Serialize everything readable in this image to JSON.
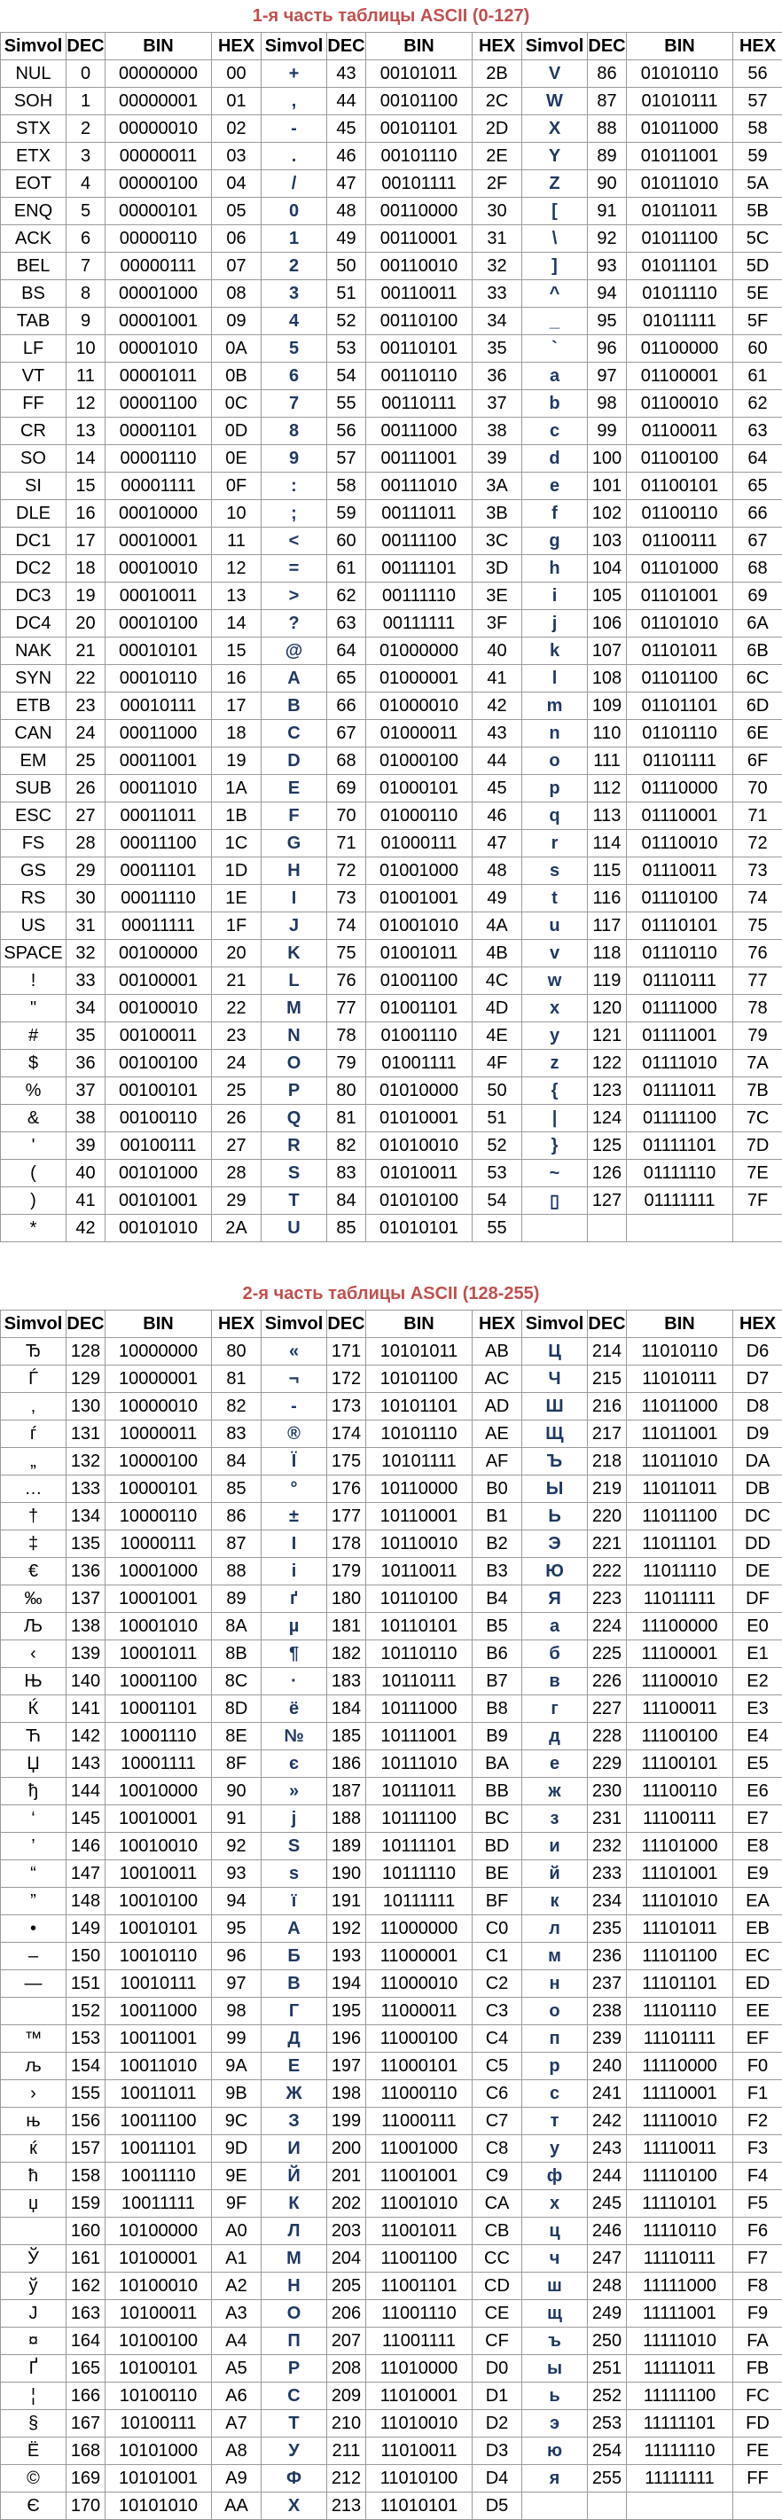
{
  "style": {
    "title_color": "#c0504d",
    "symbol_color": "#1f3864"
  },
  "part1": {
    "title": "1-я часть таблицы ASCII (0-127)",
    "headers": [
      "Simvol",
      "DEC",
      "BIN",
      "HEX",
      "Simvol",
      "DEC",
      "BIN",
      "HEX",
      "Simvol",
      "DEC",
      "BIN",
      "HEX"
    ],
    "rows": [
      [
        "NUL",
        "0",
        "00000000",
        "00",
        "+",
        "43",
        "00101011",
        "2B",
        "V",
        "86",
        "01010110",
        "56"
      ],
      [
        "SOH",
        "1",
        "00000001",
        "01",
        ",",
        "44",
        "00101100",
        "2C",
        "W",
        "87",
        "01010111",
        "57"
      ],
      [
        "STX",
        "2",
        "00000010",
        "02",
        "-",
        "45",
        "00101101",
        "2D",
        "X",
        "88",
        "01011000",
        "58"
      ],
      [
        "ETX",
        "3",
        "00000011",
        "03",
        ".",
        "46",
        "00101110",
        "2E",
        "Y",
        "89",
        "01011001",
        "59"
      ],
      [
        "EOT",
        "4",
        "00000100",
        "04",
        "/",
        "47",
        "00101111",
        "2F",
        "Z",
        "90",
        "01011010",
        "5A"
      ],
      [
        "ENQ",
        "5",
        "00000101",
        "05",
        "0",
        "48",
        "00110000",
        "30",
        "[",
        "91",
        "01011011",
        "5B"
      ],
      [
        "ACK",
        "6",
        "00000110",
        "06",
        "1",
        "49",
        "00110001",
        "31",
        "\\",
        "92",
        "01011100",
        "5C"
      ],
      [
        "BEL",
        "7",
        "00000111",
        "07",
        "2",
        "50",
        "00110010",
        "32",
        "]",
        "93",
        "01011101",
        "5D"
      ],
      [
        "BS",
        "8",
        "00001000",
        "08",
        "3",
        "51",
        "00110011",
        "33",
        "^",
        "94",
        "01011110",
        "5E"
      ],
      [
        "TAB",
        "9",
        "00001001",
        "09",
        "4",
        "52",
        "00110100",
        "34",
        "_",
        "95",
        "01011111",
        "5F"
      ],
      [
        "LF",
        "10",
        "00001010",
        "0A",
        "5",
        "53",
        "00110101",
        "35",
        "`",
        "96",
        "01100000",
        "60"
      ],
      [
        "VT",
        "11",
        "00001011",
        "0B",
        "6",
        "54",
        "00110110",
        "36",
        "a",
        "97",
        "01100001",
        "61"
      ],
      [
        "FF",
        "12",
        "00001100",
        "0C",
        "7",
        "55",
        "00110111",
        "37",
        "b",
        "98",
        "01100010",
        "62"
      ],
      [
        "CR",
        "13",
        "00001101",
        "0D",
        "8",
        "56",
        "00111000",
        "38",
        "c",
        "99",
        "01100011",
        "63"
      ],
      [
        "SO",
        "14",
        "00001110",
        "0E",
        "9",
        "57",
        "00111001",
        "39",
        "d",
        "100",
        "01100100",
        "64"
      ],
      [
        "SI",
        "15",
        "00001111",
        "0F",
        ":",
        "58",
        "00111010",
        "3A",
        "e",
        "101",
        "01100101",
        "65"
      ],
      [
        "DLE",
        "16",
        "00010000",
        "10",
        ";",
        "59",
        "00111011",
        "3B",
        "f",
        "102",
        "01100110",
        "66"
      ],
      [
        "DC1",
        "17",
        "00010001",
        "11",
        "<",
        "60",
        "00111100",
        "3C",
        "g",
        "103",
        "01100111",
        "67"
      ],
      [
        "DC2",
        "18",
        "00010010",
        "12",
        "=",
        "61",
        "00111101",
        "3D",
        "h",
        "104",
        "01101000",
        "68"
      ],
      [
        "DC3",
        "19",
        "00010011",
        "13",
        ">",
        "62",
        "00111110",
        "3E",
        "i",
        "105",
        "01101001",
        "69"
      ],
      [
        "DC4",
        "20",
        "00010100",
        "14",
        "?",
        "63",
        "00111111",
        "3F",
        "j",
        "106",
        "01101010",
        "6A"
      ],
      [
        "NAK",
        "21",
        "00010101",
        "15",
        "@",
        "64",
        "01000000",
        "40",
        "k",
        "107",
        "01101011",
        "6B"
      ],
      [
        "SYN",
        "22",
        "00010110",
        "16",
        "A",
        "65",
        "01000001",
        "41",
        "l",
        "108",
        "01101100",
        "6C"
      ],
      [
        "ETB",
        "23",
        "00010111",
        "17",
        "B",
        "66",
        "01000010",
        "42",
        "m",
        "109",
        "01101101",
        "6D"
      ],
      [
        "CAN",
        "24",
        "00011000",
        "18",
        "C",
        "67",
        "01000011",
        "43",
        "n",
        "110",
        "01101110",
        "6E"
      ],
      [
        "EM",
        "25",
        "00011001",
        "19",
        "D",
        "68",
        "01000100",
        "44",
        "o",
        "111",
        "01101111",
        "6F"
      ],
      [
        "SUB",
        "26",
        "00011010",
        "1A",
        "E",
        "69",
        "01000101",
        "45",
        "p",
        "112",
        "01110000",
        "70"
      ],
      [
        "ESC",
        "27",
        "00011011",
        "1B",
        "F",
        "70",
        "01000110",
        "46",
        "q",
        "113",
        "01110001",
        "71"
      ],
      [
        "FS",
        "28",
        "00011100",
        "1C",
        "G",
        "71",
        "01000111",
        "47",
        "r",
        "114",
        "01110010",
        "72"
      ],
      [
        "GS",
        "29",
        "00011101",
        "1D",
        "H",
        "72",
        "01001000",
        "48",
        "s",
        "115",
        "01110011",
        "73"
      ],
      [
        "RS",
        "30",
        "00011110",
        "1E",
        "I",
        "73",
        "01001001",
        "49",
        "t",
        "116",
        "01110100",
        "74"
      ],
      [
        "US",
        "31",
        "00011111",
        "1F",
        "J",
        "74",
        "01001010",
        "4A",
        "u",
        "117",
        "01110101",
        "75"
      ],
      [
        "SPACE",
        "32",
        "00100000",
        "20",
        "K",
        "75",
        "01001011",
        "4B",
        "v",
        "118",
        "01110110",
        "76"
      ],
      [
        "!",
        "33",
        "00100001",
        "21",
        "L",
        "76",
        "01001100",
        "4C",
        "w",
        "119",
        "01110111",
        "77"
      ],
      [
        "\"",
        "34",
        "00100010",
        "22",
        "M",
        "77",
        "01001101",
        "4D",
        "x",
        "120",
        "01111000",
        "78"
      ],
      [
        "#",
        "35",
        "00100011",
        "23",
        "N",
        "78",
        "01001110",
        "4E",
        "y",
        "121",
        "01111001",
        "79"
      ],
      [
        "$",
        "36",
        "00100100",
        "24",
        "O",
        "79",
        "01001111",
        "4F",
        "z",
        "122",
        "01111010",
        "7A"
      ],
      [
        "%",
        "37",
        "00100101",
        "25",
        "P",
        "80",
        "01010000",
        "50",
        "{",
        "123",
        "01111011",
        "7B"
      ],
      [
        "&",
        "38",
        "00100110",
        "26",
        "Q",
        "81",
        "01010001",
        "51",
        "|",
        "124",
        "01111100",
        "7C"
      ],
      [
        "'",
        "39",
        "00100111",
        "27",
        "R",
        "82",
        "01010010",
        "52",
        "}",
        "125",
        "01111101",
        "7D"
      ],
      [
        "(",
        "40",
        "00101000",
        "28",
        "S",
        "83",
        "01010011",
        "53",
        "~",
        "126",
        "01111110",
        "7E"
      ],
      [
        ")",
        "41",
        "00101001",
        "29",
        "T",
        "84",
        "01010100",
        "54",
        "▯",
        "127",
        "01111111",
        "7F"
      ],
      [
        "*",
        "42",
        "00101010",
        "2A",
        "U",
        "85",
        "01010101",
        "55",
        "",
        "",
        "",
        ""
      ]
    ]
  },
  "part2": {
    "title": "2-я часть таблицы ASCII (128-255)",
    "headers": [
      "Simvol",
      "DEC",
      "BIN",
      "HEX",
      "Simvol",
      "DEC",
      "BIN",
      "HEX",
      "Simvol",
      "DEC",
      "BIN",
      "HEX"
    ],
    "rows": [
      [
        "Ђ",
        "128",
        "10000000",
        "80",
        "«",
        "171",
        "10101011",
        "AB",
        "Ц",
        "214",
        "11010110",
        "D6"
      ],
      [
        "Ѓ",
        "129",
        "10000001",
        "81",
        "¬",
        "172",
        "10101100",
        "AC",
        "Ч",
        "215",
        "11010111",
        "D7"
      ],
      [
        "‚",
        "130",
        "10000010",
        "82",
        "-",
        "173",
        "10101101",
        "AD",
        "Ш",
        "216",
        "11011000",
        "D8"
      ],
      [
        "ѓ",
        "131",
        "10000011",
        "83",
        "®",
        "174",
        "10101110",
        "AE",
        "Щ",
        "217",
        "11011001",
        "D9"
      ],
      [
        "„",
        "132",
        "10000100",
        "84",
        "Ї",
        "175",
        "10101111",
        "AF",
        "Ъ",
        "218",
        "11011010",
        "DA"
      ],
      [
        "…",
        "133",
        "10000101",
        "85",
        "°",
        "176",
        "10110000",
        "B0",
        "Ы",
        "219",
        "11011011",
        "DB"
      ],
      [
        "†",
        "134",
        "10000110",
        "86",
        "±",
        "177",
        "10110001",
        "B1",
        "Ь",
        "220",
        "11011100",
        "DC"
      ],
      [
        "‡",
        "135",
        "10000111",
        "87",
        "І",
        "178",
        "10110010",
        "B2",
        "Э",
        "221",
        "11011101",
        "DD"
      ],
      [
        "€",
        "136",
        "10001000",
        "88",
        "і",
        "179",
        "10110011",
        "B3",
        "Ю",
        "222",
        "11011110",
        "DE"
      ],
      [
        "‰",
        "137",
        "10001001",
        "89",
        "ґ",
        "180",
        "10110100",
        "B4",
        "Я",
        "223",
        "11011111",
        "DF"
      ],
      [
        "Љ",
        "138",
        "10001010",
        "8A",
        "µ",
        "181",
        "10110101",
        "B5",
        "а",
        "224",
        "11100000",
        "E0"
      ],
      [
        "‹",
        "139",
        "10001011",
        "8B",
        "¶",
        "182",
        "10110110",
        "B6",
        "б",
        "225",
        "11100001",
        "E1"
      ],
      [
        "Њ",
        "140",
        "10001100",
        "8C",
        "·",
        "183",
        "10110111",
        "B7",
        "в",
        "226",
        "11100010",
        "E2"
      ],
      [
        "Ќ",
        "141",
        "10001101",
        "8D",
        "ё",
        "184",
        "10111000",
        "B8",
        "г",
        "227",
        "11100011",
        "E3"
      ],
      [
        "Ћ",
        "142",
        "10001110",
        "8E",
        "№",
        "185",
        "10111001",
        "B9",
        "д",
        "228",
        "11100100",
        "E4"
      ],
      [
        "Џ",
        "143",
        "10001111",
        "8F",
        "є",
        "186",
        "10111010",
        "BA",
        "е",
        "229",
        "11100101",
        "E5"
      ],
      [
        "ђ",
        "144",
        "10010000",
        "90",
        "»",
        "187",
        "10111011",
        "BB",
        "ж",
        "230",
        "11100110",
        "E6"
      ],
      [
        "‘",
        "145",
        "10010001",
        "91",
        "ј",
        "188",
        "10111100",
        "BC",
        "з",
        "231",
        "11100111",
        "E7"
      ],
      [
        "’",
        "146",
        "10010010",
        "92",
        "Ѕ",
        "189",
        "10111101",
        "BD",
        "и",
        "232",
        "11101000",
        "E8"
      ],
      [
        "“",
        "147",
        "10010011",
        "93",
        "ѕ",
        "190",
        "10111110",
        "BE",
        "й",
        "233",
        "11101001",
        "E9"
      ],
      [
        "”",
        "148",
        "10010100",
        "94",
        "ї",
        "191",
        "10111111",
        "BF",
        "к",
        "234",
        "11101010",
        "EA"
      ],
      [
        "•",
        "149",
        "10010101",
        "95",
        "А",
        "192",
        "11000000",
        "C0",
        "л",
        "235",
        "11101011",
        "EB"
      ],
      [
        "–",
        "150",
        "10010110",
        "96",
        "Б",
        "193",
        "11000001",
        "C1",
        "м",
        "236",
        "11101100",
        "EC"
      ],
      [
        "—",
        "151",
        "10010111",
        "97",
        "В",
        "194",
        "11000010",
        "C2",
        "н",
        "237",
        "11101101",
        "ED"
      ],
      [
        "",
        "152",
        "10011000",
        "98",
        "Г",
        "195",
        "11000011",
        "C3",
        "о",
        "238",
        "11101110",
        "EE"
      ],
      [
        "™",
        "153",
        "10011001",
        "99",
        "Д",
        "196",
        "11000100",
        "C4",
        "п",
        "239",
        "11101111",
        "EF"
      ],
      [
        "љ",
        "154",
        "10011010",
        "9A",
        "Е",
        "197",
        "11000101",
        "C5",
        "р",
        "240",
        "11110000",
        "F0"
      ],
      [
        "›",
        "155",
        "10011011",
        "9B",
        "Ж",
        "198",
        "11000110",
        "C6",
        "с",
        "241",
        "11110001",
        "F1"
      ],
      [
        "њ",
        "156",
        "10011100",
        "9C",
        "З",
        "199",
        "11000111",
        "C7",
        "т",
        "242",
        "11110010",
        "F2"
      ],
      [
        "ќ",
        "157",
        "10011101",
        "9D",
        "И",
        "200",
        "11001000",
        "C8",
        "у",
        "243",
        "11110011",
        "F3"
      ],
      [
        "ћ",
        "158",
        "10011110",
        "9E",
        "Й",
        "201",
        "11001001",
        "C9",
        "ф",
        "244",
        "11110100",
        "F4"
      ],
      [
        "џ",
        "159",
        "10011111",
        "9F",
        "К",
        "202",
        "11001010",
        "CA",
        "х",
        "245",
        "11110101",
        "F5"
      ],
      [
        "",
        "160",
        "10100000",
        "A0",
        "Л",
        "203",
        "11001011",
        "CB",
        "ц",
        "246",
        "11110110",
        "F6"
      ],
      [
        "Ў",
        "161",
        "10100001",
        "A1",
        "М",
        "204",
        "11001100",
        "CC",
        "ч",
        "247",
        "11110111",
        "F7"
      ],
      [
        "ў",
        "162",
        "10100010",
        "A2",
        "Н",
        "205",
        "11001101",
        "CD",
        "ш",
        "248",
        "11111000",
        "F8"
      ],
      [
        "Ј",
        "163",
        "10100011",
        "A3",
        "О",
        "206",
        "11001110",
        "CE",
        "щ",
        "249",
        "11111001",
        "F9"
      ],
      [
        "¤",
        "164",
        "10100100",
        "A4",
        "П",
        "207",
        "11001111",
        "CF",
        "ъ",
        "250",
        "11111010",
        "FA"
      ],
      [
        "Ґ",
        "165",
        "10100101",
        "A5",
        "Р",
        "208",
        "11010000",
        "D0",
        "ы",
        "251",
        "11111011",
        "FB"
      ],
      [
        "¦",
        "166",
        "10100110",
        "A6",
        "С",
        "209",
        "11010001",
        "D1",
        "ь",
        "252",
        "11111100",
        "FC"
      ],
      [
        "§",
        "167",
        "10100111",
        "A7",
        "Т",
        "210",
        "11010010",
        "D2",
        "э",
        "253",
        "11111101",
        "FD"
      ],
      [
        "Ё",
        "168",
        "10101000",
        "A8",
        "У",
        "211",
        "11010011",
        "D3",
        "ю",
        "254",
        "11111110",
        "FE"
      ],
      [
        "©",
        "169",
        "10101001",
        "A9",
        "Ф",
        "212",
        "11010100",
        "D4",
        "я",
        "255",
        "11111111",
        "FF"
      ],
      [
        "Є",
        "170",
        "10101010",
        "AA",
        "Х",
        "213",
        "11010101",
        "D5",
        "",
        "",
        "",
        ""
      ]
    ]
  }
}
